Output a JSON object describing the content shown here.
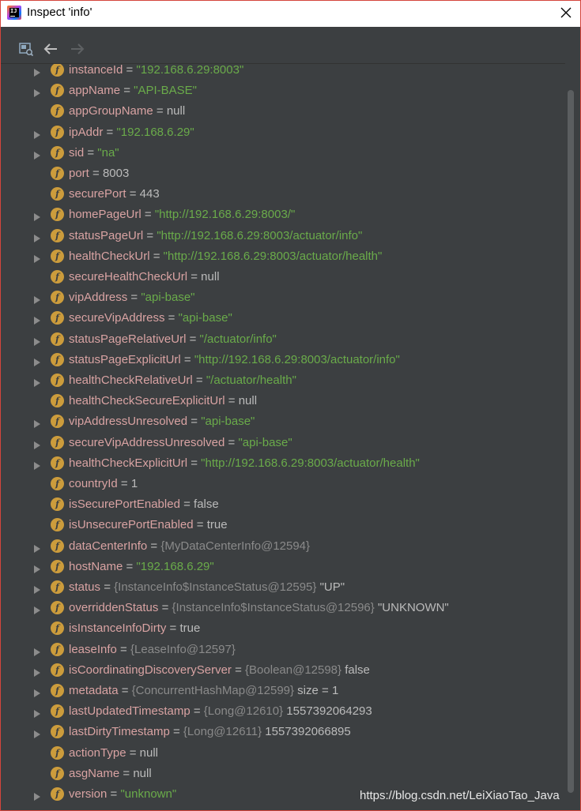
{
  "window": {
    "title": "Inspect 'info'"
  },
  "toolbar": {
    "buttons": [
      {
        "icon": "inspect-icon"
      },
      {
        "icon": "back-arrow-icon"
      },
      {
        "icon": "forward-arrow-icon"
      }
    ]
  },
  "fields": [
    {
      "expandable": true,
      "name": "instanceId",
      "parts": [
        {
          "t": "str",
          "v": "\"192.168.6.29:8003\""
        }
      ]
    },
    {
      "expandable": true,
      "name": "appName",
      "parts": [
        {
          "t": "str",
          "v": "\"API-BASE\""
        }
      ]
    },
    {
      "expandable": false,
      "name": "appGroupName",
      "parts": [
        {
          "t": "val",
          "v": "null"
        }
      ]
    },
    {
      "expandable": true,
      "name": "ipAddr",
      "parts": [
        {
          "t": "str",
          "v": "\"192.168.6.29\""
        }
      ]
    },
    {
      "expandable": true,
      "name": "sid",
      "parts": [
        {
          "t": "str",
          "v": "\"na\""
        }
      ]
    },
    {
      "expandable": false,
      "name": "port",
      "parts": [
        {
          "t": "val",
          "v": "8003"
        }
      ]
    },
    {
      "expandable": false,
      "name": "securePort",
      "parts": [
        {
          "t": "val",
          "v": "443"
        }
      ]
    },
    {
      "expandable": true,
      "name": "homePageUrl",
      "parts": [
        {
          "t": "str",
          "v": "\"http://192.168.6.29:8003/\""
        }
      ]
    },
    {
      "expandable": true,
      "name": "statusPageUrl",
      "parts": [
        {
          "t": "str",
          "v": "\"http://192.168.6.29:8003/actuator/info\""
        }
      ]
    },
    {
      "expandable": true,
      "name": "healthCheckUrl",
      "parts": [
        {
          "t": "str",
          "v": "\"http://192.168.6.29:8003/actuator/health\""
        }
      ]
    },
    {
      "expandable": false,
      "name": "secureHealthCheckUrl",
      "parts": [
        {
          "t": "val",
          "v": "null"
        }
      ]
    },
    {
      "expandable": true,
      "name": "vipAddress",
      "parts": [
        {
          "t": "str",
          "v": "\"api-base\""
        }
      ]
    },
    {
      "expandable": true,
      "name": "secureVipAddress",
      "parts": [
        {
          "t": "str",
          "v": "\"api-base\""
        }
      ]
    },
    {
      "expandable": true,
      "name": "statusPageRelativeUrl",
      "parts": [
        {
          "t": "str",
          "v": "\"/actuator/info\""
        }
      ]
    },
    {
      "expandable": true,
      "name": "statusPageExplicitUrl",
      "parts": [
        {
          "t": "str",
          "v": "\"http://192.168.6.29:8003/actuator/info\""
        }
      ]
    },
    {
      "expandable": true,
      "name": "healthCheckRelativeUrl",
      "parts": [
        {
          "t": "str",
          "v": "\"/actuator/health\""
        }
      ]
    },
    {
      "expandable": false,
      "name": "healthCheckSecureExplicitUrl",
      "parts": [
        {
          "t": "val",
          "v": "null"
        }
      ]
    },
    {
      "expandable": true,
      "name": "vipAddressUnresolved",
      "parts": [
        {
          "t": "str",
          "v": "\"api-base\""
        }
      ]
    },
    {
      "expandable": true,
      "name": "secureVipAddressUnresolved",
      "parts": [
        {
          "t": "str",
          "v": "\"api-base\""
        }
      ]
    },
    {
      "expandable": true,
      "name": "healthCheckExplicitUrl",
      "parts": [
        {
          "t": "str",
          "v": "\"http://192.168.6.29:8003/actuator/health\""
        }
      ]
    },
    {
      "expandable": false,
      "name": "countryId",
      "parts": [
        {
          "t": "val",
          "v": "1"
        }
      ]
    },
    {
      "expandable": false,
      "name": "isSecurePortEnabled",
      "parts": [
        {
          "t": "val",
          "v": "false"
        }
      ]
    },
    {
      "expandable": false,
      "name": "isUnsecurePortEnabled",
      "parts": [
        {
          "t": "val",
          "v": "true"
        }
      ]
    },
    {
      "expandable": true,
      "name": "dataCenterInfo",
      "parts": [
        {
          "t": "ref",
          "v": "{MyDataCenterInfo@12594}"
        }
      ]
    },
    {
      "expandable": true,
      "name": "hostName",
      "parts": [
        {
          "t": "str",
          "v": "\"192.168.6.29\""
        }
      ]
    },
    {
      "expandable": true,
      "name": "status",
      "parts": [
        {
          "t": "ref",
          "v": "{InstanceInfo$InstanceStatus@12595}"
        },
        {
          "t": "val",
          "v": " \"UP\""
        }
      ]
    },
    {
      "expandable": true,
      "name": "overriddenStatus",
      "parts": [
        {
          "t": "ref",
          "v": "{InstanceInfo$InstanceStatus@12596}"
        },
        {
          "t": "val",
          "v": " \"UNKNOWN\""
        }
      ]
    },
    {
      "expandable": false,
      "name": "isInstanceInfoDirty",
      "parts": [
        {
          "t": "val",
          "v": "true"
        }
      ]
    },
    {
      "expandable": true,
      "name": "leaseInfo",
      "parts": [
        {
          "t": "ref",
          "v": "{LeaseInfo@12597}"
        }
      ]
    },
    {
      "expandable": true,
      "name": "isCoordinatingDiscoveryServer",
      "parts": [
        {
          "t": "ref",
          "v": "{Boolean@12598}"
        },
        {
          "t": "val",
          "v": " false"
        }
      ]
    },
    {
      "expandable": true,
      "name": "metadata",
      "parts": [
        {
          "t": "ref",
          "v": "{ConcurrentHashMap@12599}"
        },
        {
          "t": "val",
          "v": "  size = 1"
        }
      ]
    },
    {
      "expandable": true,
      "name": "lastUpdatedTimestamp",
      "parts": [
        {
          "t": "ref",
          "v": "{Long@12610}"
        },
        {
          "t": "val",
          "v": " 1557392064293"
        }
      ]
    },
    {
      "expandable": true,
      "name": "lastDirtyTimestamp",
      "parts": [
        {
          "t": "ref",
          "v": "{Long@12611}"
        },
        {
          "t": "val",
          "v": " 1557392066895"
        }
      ]
    },
    {
      "expandable": false,
      "name": "actionType",
      "parts": [
        {
          "t": "val",
          "v": "null"
        }
      ]
    },
    {
      "expandable": false,
      "name": "asgName",
      "parts": [
        {
          "t": "val",
          "v": "null"
        }
      ]
    },
    {
      "expandable": true,
      "name": "version",
      "parts": [
        {
          "t": "str",
          "v": "\"unknown\""
        }
      ]
    }
  ],
  "field_icon_letter": "f",
  "equals": " = ",
  "watermark": "https://blog.csdn.net/LeiXiaoTao_Java",
  "colors": {
    "window_bg": "#3c3f41",
    "field_name": "#d9a3a3",
    "string_value": "#6aab4a",
    "reference": "#8a8a8a",
    "plain_value": "#bbbbbb",
    "field_icon": "#cc9c3c",
    "window_border": "#d4453c"
  }
}
